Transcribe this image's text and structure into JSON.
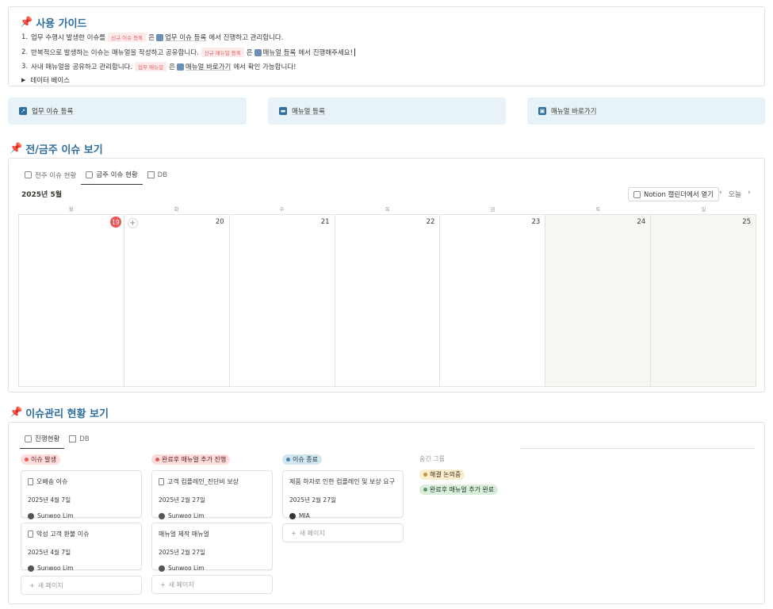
{
  "guide": {
    "title": "사용 가이드",
    "line1": {
      "n": "1.",
      "a": "업무 수행시 발생한 이슈를",
      "tag": "신규 이슈 등록",
      "b": "은",
      "link": "업무 이슈 등록",
      "c": "에서 진행하고 관리합니다."
    },
    "line2": {
      "n": "2.",
      "a": "반복적으로 발생하는 이슈는 매뉴얼을 작성하고 공유합니다.",
      "tag": "신규 매뉴얼 등록",
      "b": "은",
      "link": "매뉴얼 등록",
      "c": "에서 진행해주세요!"
    },
    "line3": {
      "n": "3.",
      "a": "사내 매뉴얼을 공유하고 관리합니다.",
      "tag": "업무 매뉴얼",
      "b": "은",
      "link": "매뉴얼 바로가기",
      "c": "에서 확인 가능합니다!"
    },
    "toggle": "데이터 베이스"
  },
  "buttons": {
    "issue": "업무 이슈 등록",
    "manual": "매뉴얼 등록",
    "shortcut": "매뉴얼 바로가기"
  },
  "calendar": {
    "heading": "전/금주 이슈 보기",
    "views": [
      "전주 이슈 현황",
      "금주 이슈 현황",
      "DB"
    ],
    "month": "2025년 5월",
    "open": "Notion 캘린더에서 열기",
    "today": "오늘",
    "weekdays": [
      "월",
      "화",
      "수",
      "목",
      "금",
      "토",
      "일"
    ],
    "days": [
      "19",
      "20",
      "21",
      "22",
      "23",
      "24",
      "25"
    ]
  },
  "board": {
    "heading": "이슈관리 현황 보기",
    "views": [
      "진행현황",
      "DB"
    ],
    "columns": [
      {
        "label": "이슈 발생"
      },
      {
        "label": "완료후 매뉴얼 추가 진행"
      },
      {
        "label": "이슈 종료"
      }
    ],
    "cards": [
      {
        "title": "오배송 이슈",
        "date": "2025년 4월 7일",
        "user": "Sunwoo Lim"
      },
      {
        "title": "악성 고객 환불 이슈",
        "date": "2025년 4월 7일",
        "user": "Sunwoo Lim"
      },
      {
        "title": "고객 컴플레인_진단비 보상",
        "date": "2025년 2월 27일",
        "user": "Sunwoo Lim"
      },
      {
        "title": "매뉴얼 제작 매뉴얼",
        "date": "2025년 2월 27일",
        "user": "Sunwoo Lim"
      },
      {
        "title": "제품 하자로 인한 컴플레인 및 보상 요구",
        "date": "2025년 2월 27일",
        "user": "MIA"
      }
    ],
    "new_page": "새 페이지",
    "hidden": {
      "title": "숨긴 그룹",
      "items": [
        "해결 논의중",
        "완료후 매뉴얼 추가 완료"
      ]
    }
  },
  "colors": {
    "accent": "#2e6e9e",
    "red": "#eb5757",
    "callout": "#e7f3f8"
  }
}
